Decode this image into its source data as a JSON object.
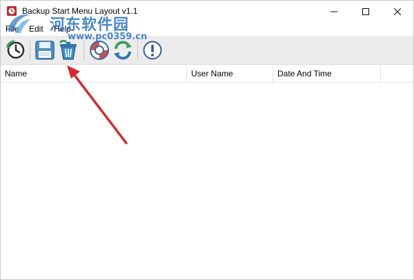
{
  "window": {
    "title": "Backup Start Menu Layout v1.1",
    "controls": {
      "minimize": "minimize-icon",
      "maximize": "maximize-icon",
      "close": "close-icon"
    }
  },
  "watermark": {
    "text_cn": "河东软件园",
    "url": "www.pc0359.cn"
  },
  "menu": {
    "items": [
      {
        "label": "File"
      },
      {
        "label": "Edit"
      },
      {
        "label": "Help"
      }
    ]
  },
  "toolbar": {
    "buttons": [
      {
        "icon": "restore-clock-icon"
      },
      {
        "icon": "save-floppy-icon"
      },
      {
        "icon": "delete-trash-icon"
      },
      {
        "icon": "help-lifebuoy-icon"
      },
      {
        "icon": "refresh-icon"
      },
      {
        "icon": "info-exclamation-icon"
      }
    ]
  },
  "list": {
    "columns": [
      {
        "label": "Name"
      },
      {
        "label": "User Name"
      },
      {
        "label": "Date And Time"
      }
    ],
    "rows": []
  },
  "colors": {
    "annotation_arrow": "#d9262a",
    "toolbar_bg": "#ececec",
    "watermark": "#2a73c4"
  }
}
